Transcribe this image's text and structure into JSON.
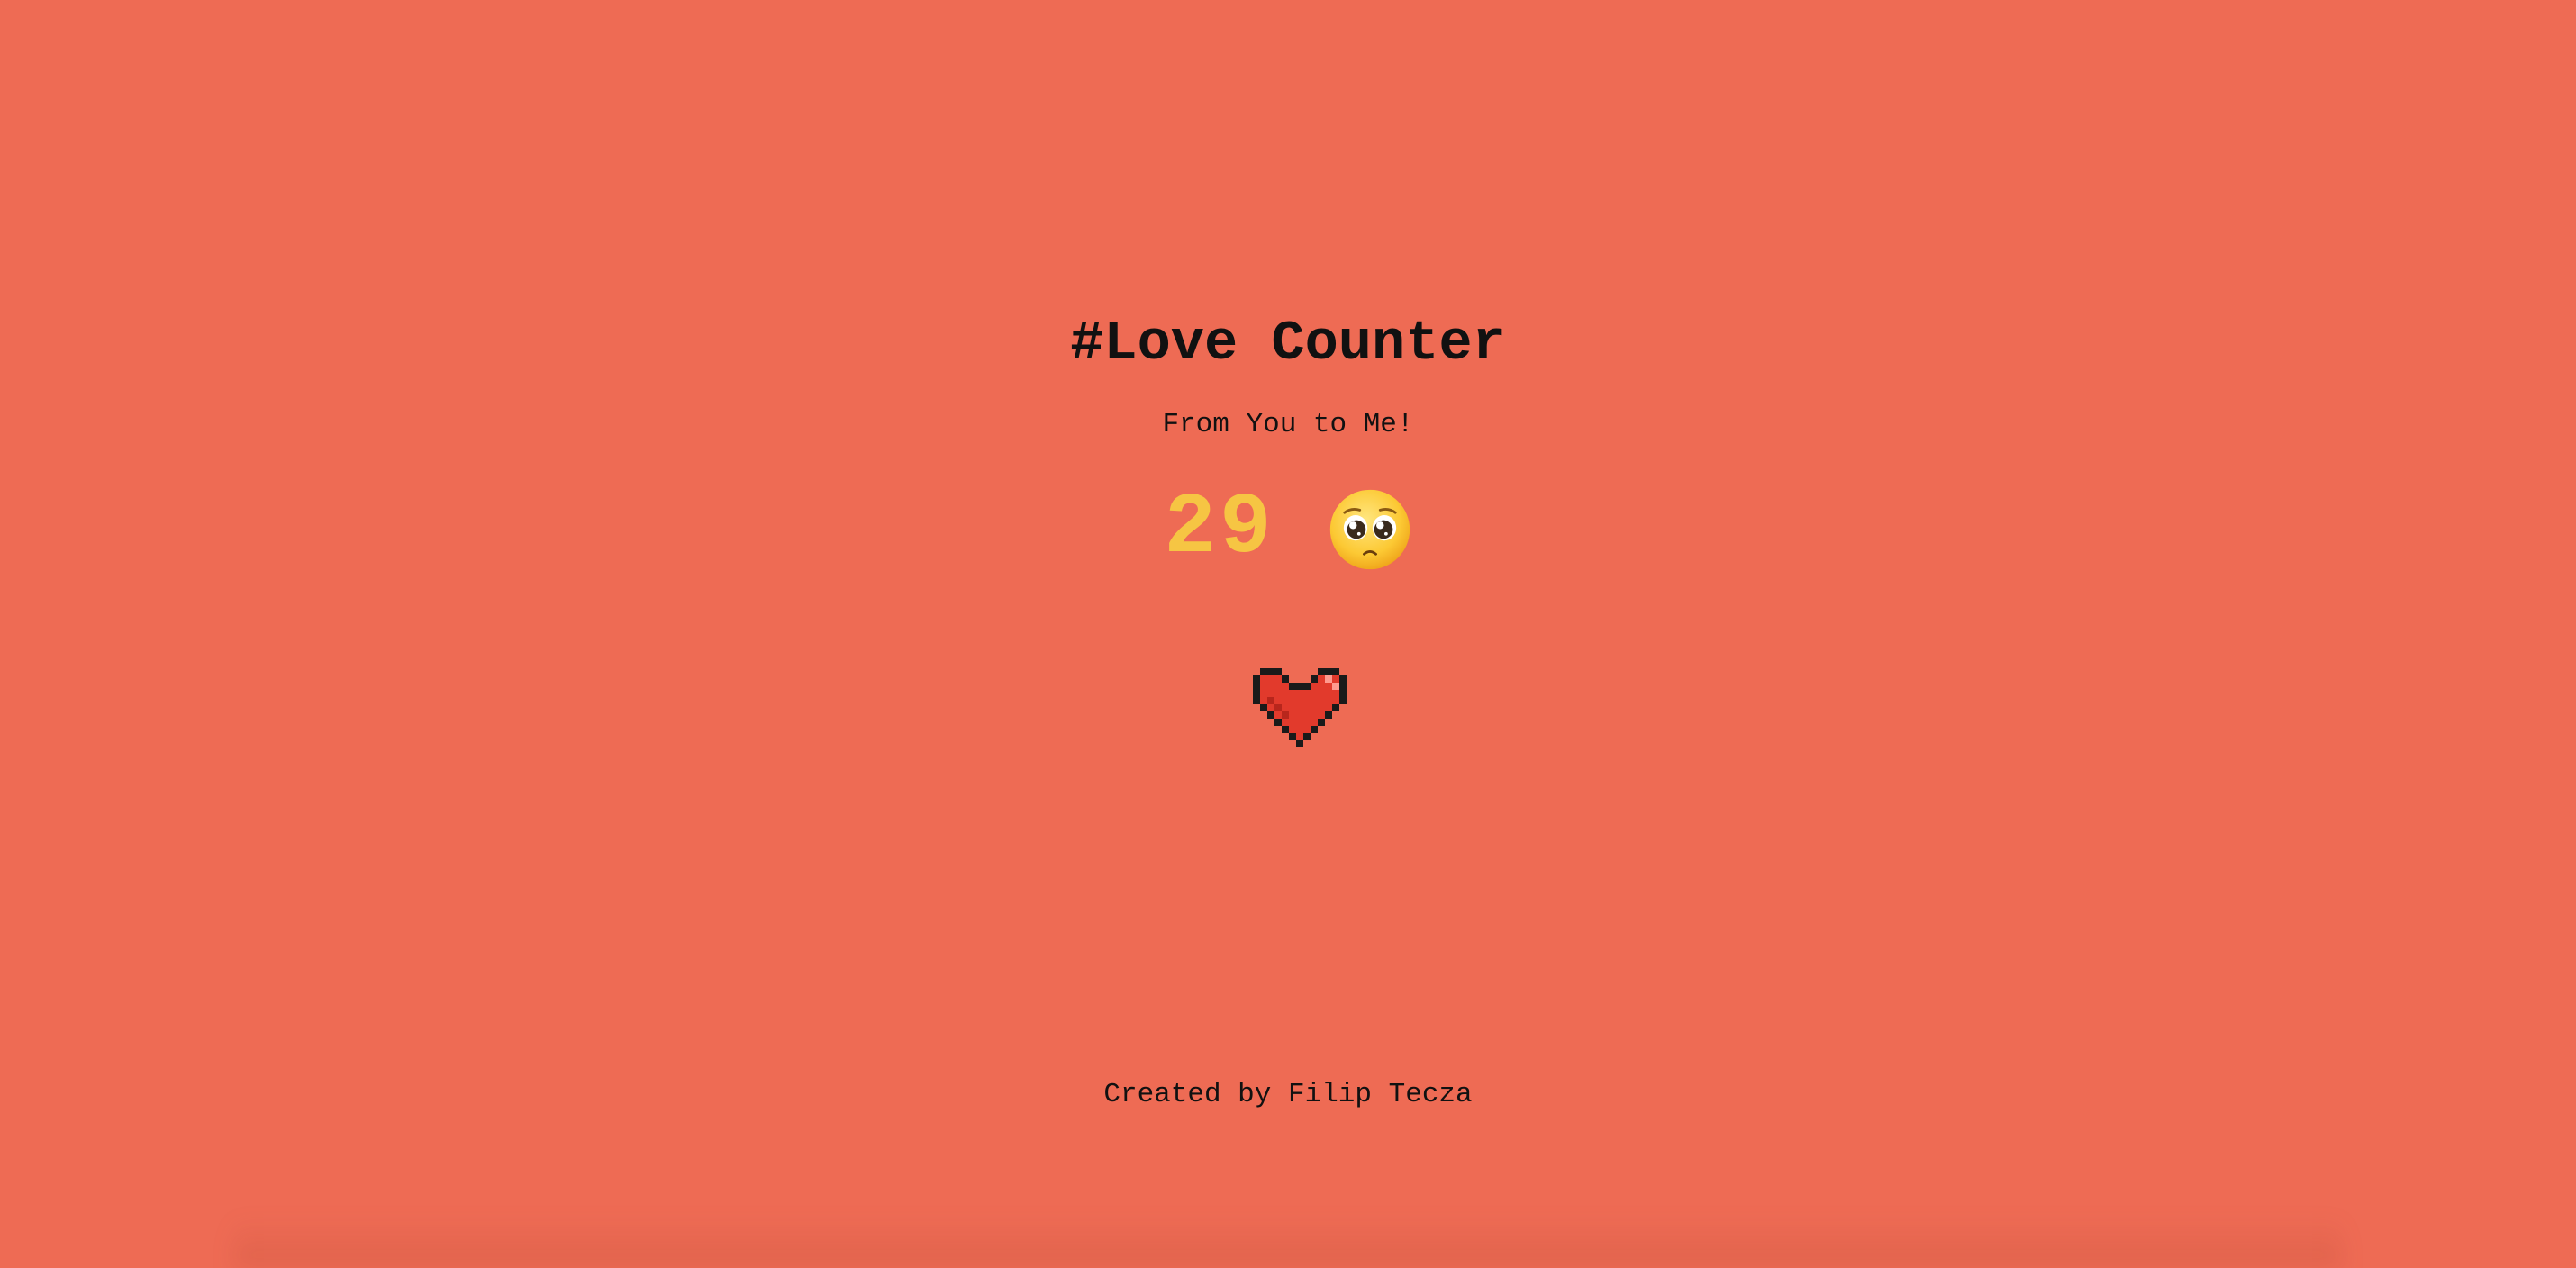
{
  "page": {
    "title": "#Love Counter",
    "subtitle": "From You to Me!",
    "footer": "Created by Filip Tecza"
  },
  "counter": {
    "value": "29",
    "emoji_icon": "pleading-face-icon"
  },
  "heart_button": {
    "icon": "pixel-heart-icon"
  },
  "colors": {
    "background": "#ee6b54",
    "counter": "#f6c543",
    "heart": "#e23a2c",
    "text": "#111111"
  }
}
